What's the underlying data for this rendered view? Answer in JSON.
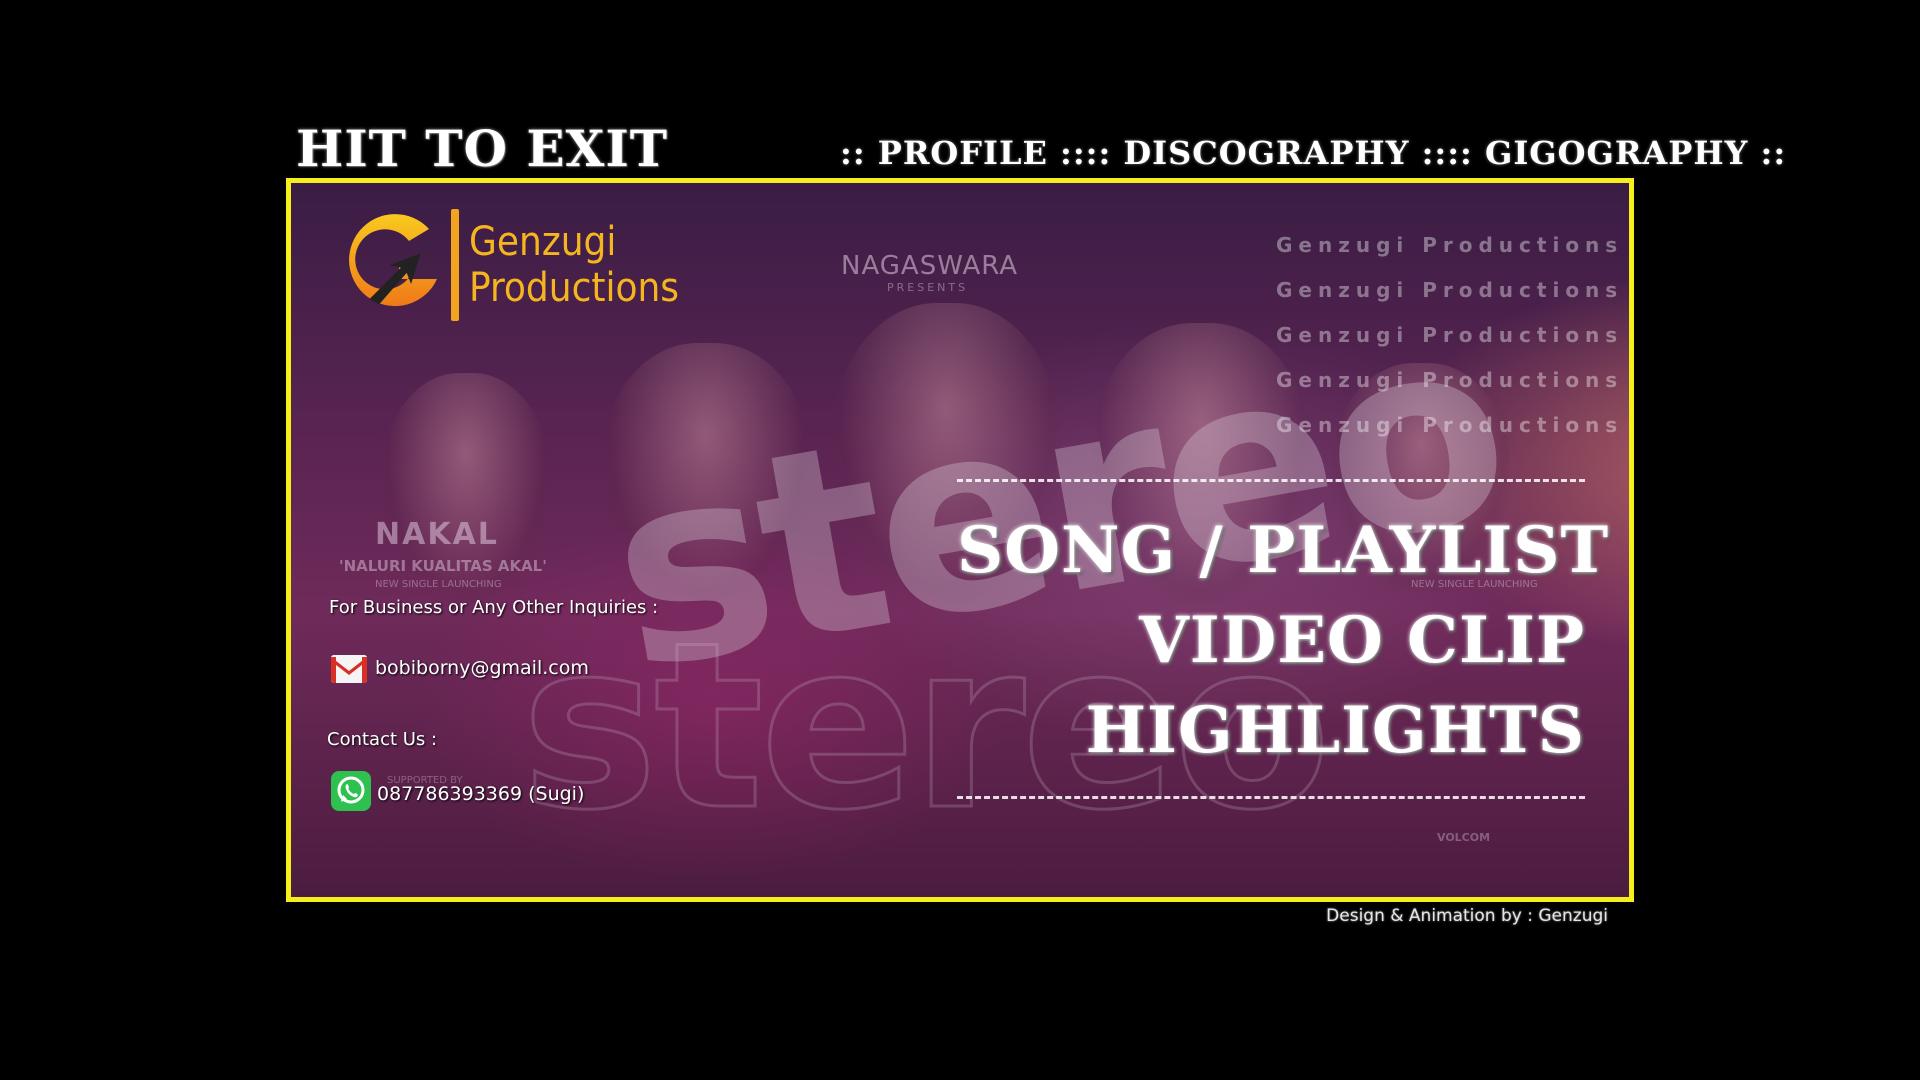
{
  "exit_label": "HIT TO EXIT",
  "nav": {
    "items": [
      {
        "label": ":: PROFILE ::"
      },
      {
        "label": ":: DISCOGRAPHY ::"
      },
      {
        "label": ":: GIGOGRAPHY ::"
      }
    ]
  },
  "logo": {
    "line1": "Genzugi",
    "line2": "Productions",
    "mark_color": "#f3a41e"
  },
  "background": {
    "presenter": "NAGASWARA",
    "presents": "PRESENTS",
    "single_title": "NAKAL",
    "single_subtitle": "'NALURI KUALITAS AKAL'",
    "single_caption": "NEW SINGLE LAUNCHING",
    "single_caption_right": "NEW SINGLE LAUNCHING",
    "band_logo": "stereo",
    "watermark": "Genzugi Productions",
    "supported_by": "SUPPORTED BY",
    "sponsor": "VOLCOM"
  },
  "contact": {
    "inquiry_label": "For Business or Any Other Inquiries :",
    "email": "bobiborny@gmail.com",
    "contact_label": "Contact Us :",
    "phone": "087786393369 (Sugi)"
  },
  "menu": {
    "items": [
      {
        "label": "SONG / PLAYLIST"
      },
      {
        "label": "VIDEO CLIP"
      },
      {
        "label": "HIGHLIGHTS"
      }
    ]
  },
  "credit": "Design & Animation by : Genzugi",
  "colors": {
    "frame_border": "#f7ef1c",
    "logo_accent": "#f4b51f",
    "whatsapp_green": "#2fc14f",
    "gmail_red": "#d93025"
  }
}
